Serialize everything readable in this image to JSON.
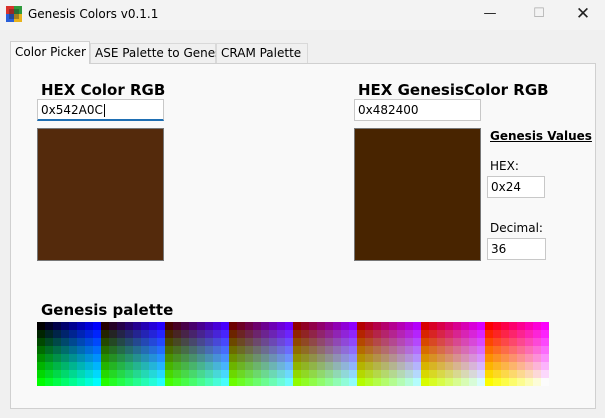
{
  "window": {
    "title": "Genesis Colors v0.1.1",
    "minimize_glyph": "—",
    "maximize_glyph": "☐",
    "close_glyph": "✕"
  },
  "tabs": [
    {
      "label": "Color Picker",
      "active": true
    },
    {
      "label": "ASE Palette to Genesis",
      "active": false
    },
    {
      "label": "CRAM Palette",
      "active": false
    }
  ],
  "color_picker": {
    "hex_rgb_heading": "HEX Color RGB",
    "hex_rgb_value": "0x542A0C",
    "hex_rgb_swatch_color": "#542A0C",
    "genesis_heading": "HEX GenesisColor RGB",
    "genesis_value": "0x482400",
    "genesis_swatch_color": "#482400",
    "genesis_values_heading": "Genesis Values",
    "hex_label": "HEX:",
    "hex_value": "0x24",
    "decimal_label": "Decimal:",
    "decimal_value": "36",
    "palette_heading": "Genesis palette"
  },
  "colors": {
    "accent": "#1f6fb3",
    "window_bg": "#f0f0f0",
    "panel_bg": "#f9f9f9"
  }
}
